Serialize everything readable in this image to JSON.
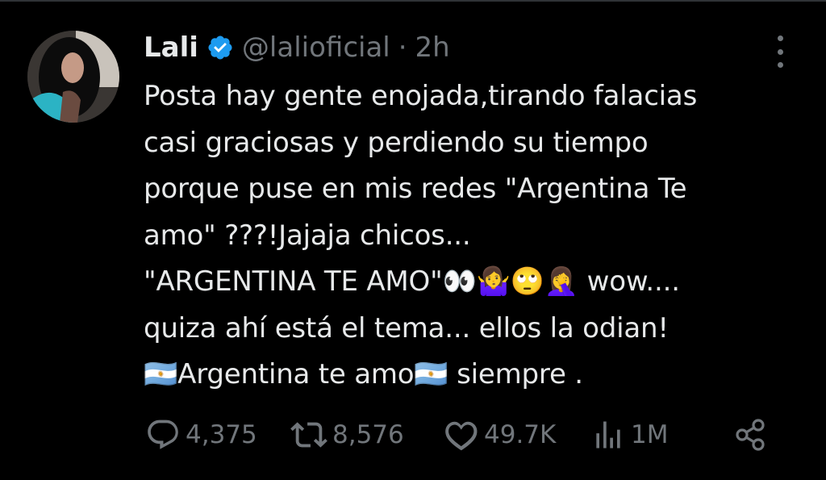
{
  "author": {
    "name": "Lali",
    "handle": "@lalioficial",
    "separator": "·",
    "time": "2h"
  },
  "tweet": {
    "text": "Posta hay gente enojada,tirando falacias\ncasi graciosas y perdiendo su tiempo\nporque puse en mis redes \"Argentina Te\namo\" ???!Jajaja chicos...\n\"ARGENTINA TE AMO\"👀🤷‍♀️🙄🤦‍♀️ wow....\nquiza ahí está el tema... ellos la odian!\n🇦🇷Argentina te amo🇦🇷 siempre ."
  },
  "actions": {
    "replies": "4,375",
    "retweets": "8,576",
    "likes": "49.7K",
    "views": "1M"
  },
  "colors": {
    "accent_verified": "#1d9bf0",
    "text": "#e7e9ea",
    "muted": "#71767b",
    "background": "#000000"
  },
  "icons": [
    "avatar",
    "verified-badge-icon",
    "more-options-icon",
    "reply-icon",
    "retweet-icon",
    "like-icon",
    "views-icon",
    "share-icon"
  ]
}
